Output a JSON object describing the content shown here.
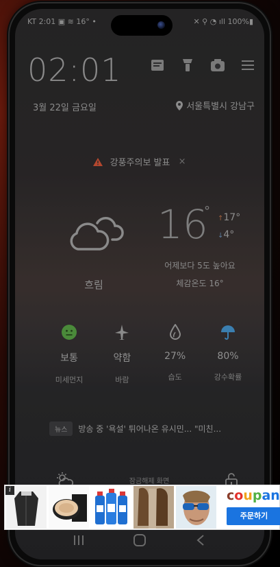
{
  "status_bar": {
    "left": "KT 2:01 ▣ ≋ 16° •",
    "right": "✕ ⚲ ◔ ıll 100%▮"
  },
  "lock_screen": {
    "time": "02:01",
    "date": "3월 22일 금요일",
    "location": "서울특별시 강남구",
    "alert": "강풍주의보 발표",
    "alert_close": "×",
    "weather": {
      "condition": "흐림",
      "temperature": "16",
      "degree_symbol": "°",
      "high": "17°",
      "low": "4°",
      "comparison": "어제보다 5도 높아요",
      "feels_like": "체감온도 16°"
    },
    "metrics": [
      {
        "value": "보통",
        "label": "미세먼지",
        "icon": "face-icon"
      },
      {
        "value": "약함",
        "label": "바람",
        "icon": "wind-icon"
      },
      {
        "value": "27%",
        "label": "습도",
        "icon": "droplet-icon"
      },
      {
        "value": "80%",
        "label": "강수확률",
        "icon": "umbrella-icon"
      }
    ],
    "news": {
      "tag": "뉴스",
      "headline": "방송 중 '욕설' 튀어나온 유시민... \"미친..."
    },
    "swipe_hint": "잠금해제 화면"
  },
  "ad_banner": {
    "info": "i",
    "brand": "coupang",
    "cta": "주문하기",
    "brand_colors": [
      "#1a74e0",
      "#e4302b",
      "#f0a21b",
      "#52b043"
    ]
  }
}
